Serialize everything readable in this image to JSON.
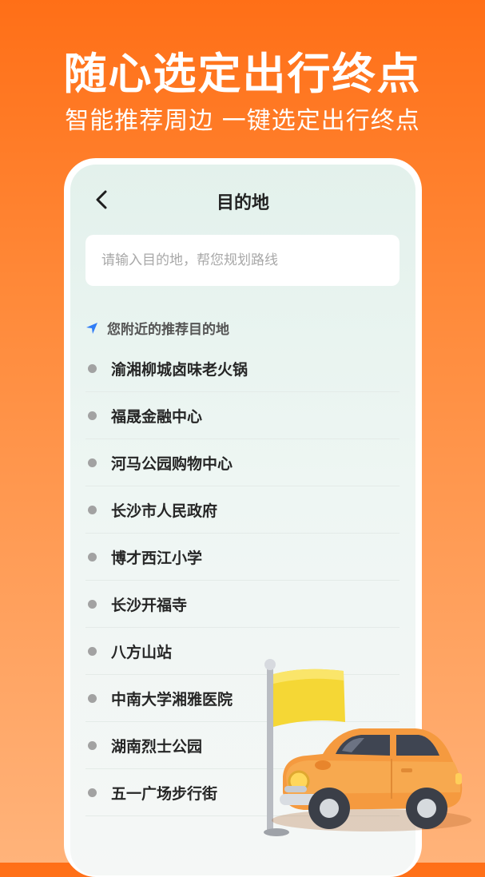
{
  "hero": {
    "title": "随心选定出行终点",
    "subtitle": "智能推荐周边 一键选定出行终点"
  },
  "nav": {
    "title": "目的地",
    "back_icon": "chevron-left-icon"
  },
  "search": {
    "placeholder": "请输入目的地，帮您规划路线",
    "value": ""
  },
  "recommend": {
    "heading": "您附近的推荐目的地",
    "icon": "location-arrow-icon",
    "icon_color": "#2f7cf6",
    "items": [
      {
        "label": "渝湘柳城卤味老火锅"
      },
      {
        "label": "福晟金融中心"
      },
      {
        "label": "河马公园购物中心"
      },
      {
        "label": "长沙市人民政府"
      },
      {
        "label": "博才西江小学"
      },
      {
        "label": "长沙开福寺"
      },
      {
        "label": "八方山站"
      },
      {
        "label": "中南大学湘雅医院"
      },
      {
        "label": "湖南烈士公园"
      },
      {
        "label": "五一广场步行街"
      }
    ]
  },
  "colors": {
    "brand_orange": "#ff6f17",
    "flag_yellow": "#f5d735",
    "car_orange": "#f59a3f"
  },
  "illustration": "car-with-flag-icon"
}
